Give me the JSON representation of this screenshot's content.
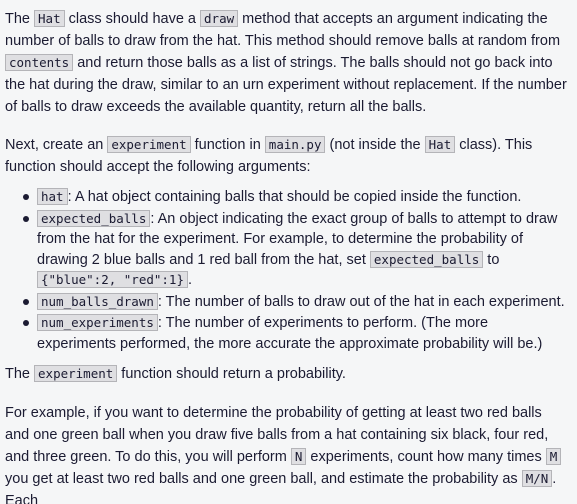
{
  "paragraph1": {
    "t1": "The ",
    "c1": "Hat",
    "t2": " class should have a ",
    "c2": "draw",
    "t3": " method that accepts an argument indicating the number of balls to draw from the hat. This method should remove balls at random from ",
    "c3": "contents",
    "t4": " and return those balls as a list of strings. The balls should not go back into the hat during the draw, similar to an urn experiment without replacement. If the number of balls to draw exceeds the available quantity, return all the balls."
  },
  "paragraph2": {
    "t1": "Next, create an ",
    "c1": "experiment",
    "t2": " function in ",
    "c2": "main.py",
    "t3": " (not inside the ",
    "c3": "Hat",
    "t4": " class). This function should accept the following arguments:"
  },
  "args": [
    {
      "code": "hat",
      "text": ": A hat object containing balls that should be copied inside the function."
    },
    {
      "code": "expected_balls",
      "text": ": An object indicating the exact group of balls to attempt to draw from the hat for the experiment. For example, to determine the probability of drawing 2 blue balls and 1 red ball from the hat, set ",
      "code2": "expected_balls",
      "text2": " to ",
      "code3": "{\"blue\":2, \"red\":1}",
      "text3": "."
    },
    {
      "code": "num_balls_drawn",
      "text": ": The number of balls to draw out of the hat in each experiment."
    },
    {
      "code": "num_experiments",
      "text": ": The number of experiments to perform. (The more experiments performed, the more accurate the approximate probability will be.)"
    }
  ],
  "paragraph3": {
    "t1": "The ",
    "c1": "experiment",
    "t2": " function should return a probability."
  },
  "paragraph4": {
    "t1": "For example, if you want to determine the probability of getting at least two red balls and one green ball when you draw five balls from a hat containing six black, four red, and three green. To do this, you will perform ",
    "c1": "N",
    "t2": " experiments, count how many times ",
    "c2": "M",
    "t3": " you get at least two red balls and one green ball, and estimate the probability as ",
    "c3": "M/N",
    "t4": ". Each"
  }
}
